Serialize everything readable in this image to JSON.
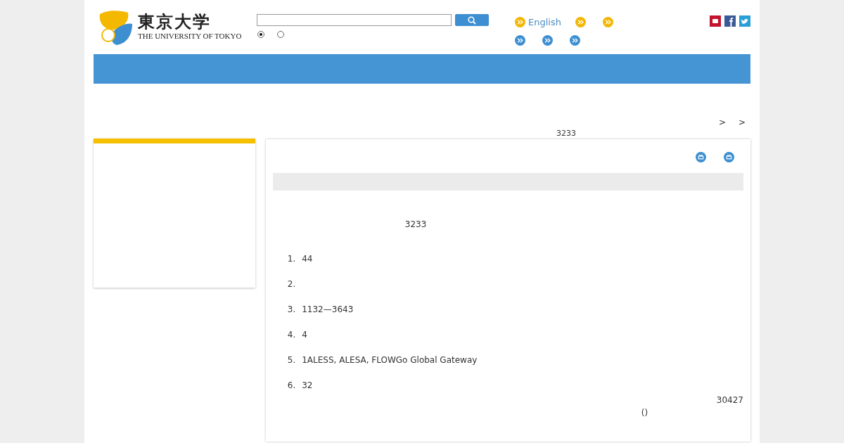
{
  "logo": {
    "title": "東京大学",
    "subtitle": "THE UNIVERSITY OF TOKYO"
  },
  "search": {
    "scopes": [
      {
        "selected": true
      },
      {
        "selected": false
      }
    ]
  },
  "links": [
    {
      "kind": "primary",
      "label": "English"
    },
    {
      "kind": "primary"
    },
    {
      "kind": "primary"
    },
    {
      "kind": "secondary"
    },
    {
      "kind": "secondary"
    },
    {
      "kind": "secondary"
    }
  ],
  "breadcrumb": [
    ">",
    ">"
  ],
  "page_number": "3233",
  "content": {
    "heading": "3233",
    "items": [
      {
        "number": "1.",
        "text": "44"
      },
      {
        "number": "2."
      },
      {
        "number": "3.",
        "text": "1132—3643"
      },
      {
        "number": "4.",
        "text": "4"
      },
      {
        "number": "5.",
        "text": "1ALESS, ALESA, FLOWGo Global Gateway"
      },
      {
        "number": "6.",
        "text": "32"
      }
    ],
    "date": "30427",
    "note": "()"
  }
}
